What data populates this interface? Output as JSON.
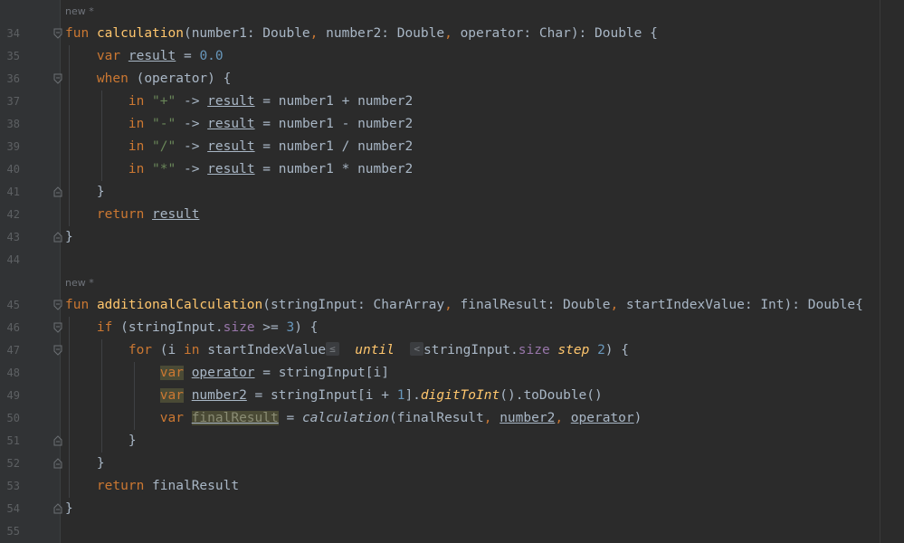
{
  "editor": {
    "hints": [
      {
        "id": "hint-1",
        "text": "new *"
      },
      {
        "id": "hint-2",
        "text": "new *"
      }
    ],
    "lines": [
      {
        "num": "34"
      },
      {
        "num": "35"
      },
      {
        "num": "36"
      },
      {
        "num": "37"
      },
      {
        "num": "38"
      },
      {
        "num": "39"
      },
      {
        "num": "40"
      },
      {
        "num": "41"
      },
      {
        "num": "42"
      },
      {
        "num": "43"
      },
      {
        "num": "44"
      },
      {
        "num": "45"
      },
      {
        "num": "46"
      },
      {
        "num": "47"
      },
      {
        "num": "48"
      },
      {
        "num": "49"
      },
      {
        "num": "50"
      },
      {
        "num": "51"
      },
      {
        "num": "52"
      },
      {
        "num": "53"
      },
      {
        "num": "54"
      },
      {
        "num": "55"
      }
    ],
    "inlay_hints": {
      "le": "≤",
      "lt": "<"
    },
    "tokens": {
      "fun": "fun",
      "var": "var",
      "when": "when",
      "in": "in",
      "return": "return",
      "if": "if",
      "for": "for",
      "until": "until",
      "step": "step",
      "calculation": "calculation",
      "additionalCalculation": "additionalCalculation",
      "result": "result",
      "finalResult": "finalResult",
      "operator": "operator",
      "number1": "number1",
      "number2": "number2",
      "stringInput": "stringInput",
      "startIndexValue": "startIndexValue",
      "size": "size",
      "digitToInt": "digitToInt",
      "toDouble": "toDouble",
      "i": "i",
      "Double": "Double",
      "Char": "Char",
      "CharArray": "CharArray",
      "Int": "Int",
      "zero": "0.0",
      "three": "3",
      "one": "1",
      "two": "2",
      "plus": "\"+\"",
      "minus": "\"-\"",
      "slash": "\"/\"",
      "star": "\"*\""
    }
  }
}
